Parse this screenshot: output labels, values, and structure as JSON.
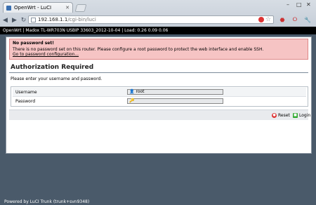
{
  "browser": {
    "tab_title": "OpenWrt - LuCI",
    "url_host": "192.168.1.1",
    "url_path": "/cgi-bin/luci"
  },
  "header": {
    "text": "OpenWrt | Madox TL-WR703N USBIP 33603_2012-10-04 | Load: 0.26 0.09 0.06"
  },
  "warning": {
    "title": "No password set!",
    "body": "There is no password set on this router. Please configure a root password to protect the web interface and enable SSH.",
    "link": "Go to password configuration..."
  },
  "auth": {
    "heading": "Authorization Required",
    "hint": "Please enter your username and password.",
    "username_label": "Username",
    "username_value": "root",
    "password_label": "Password",
    "password_value": ""
  },
  "buttons": {
    "reset": "Reset",
    "login": "Login"
  },
  "footer": {
    "powered": "Powered by LuCI Trunk (trunk+svn9348)"
  },
  "colors": {
    "warning_bg": "#f6c4c4",
    "header_bg": "#000000",
    "page_bg": "#4a5a6a"
  }
}
